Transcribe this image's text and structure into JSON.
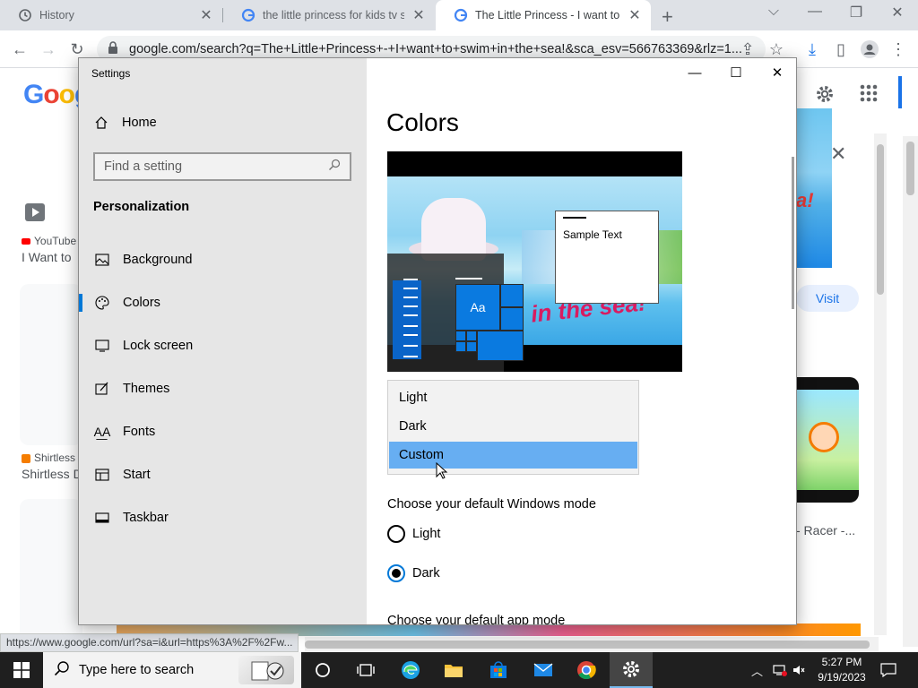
{
  "browser": {
    "tabs": [
      {
        "title": "History",
        "icon": "history-icon"
      },
      {
        "title": "the little princess for kids tv swim",
        "icon": "google-icon"
      },
      {
        "title": "The Little Princess - I want to swim",
        "icon": "google-icon",
        "active": true
      }
    ],
    "address": "google.com/search?q=The+Little+Princess+-+I+want+to+swim+in+the+sea!&sca_esv=566763369&rlz=1..."
  },
  "google": {
    "logo": "Goog",
    "results": [
      {
        "source": "YouTube",
        "title": "I Want to"
      },
      {
        "source": "Shirtless",
        "title": "Shirtless D"
      }
    ],
    "visit_label": "Visit",
    "racer_label": "- Racer -...",
    "status_url": "https://www.google.com/url?sa=i&url=https%3A%2F%2Fw..."
  },
  "settings": {
    "window_title": "Settings",
    "home_label": "Home",
    "search_placeholder": "Find a setting",
    "section": "Personalization",
    "nav": [
      {
        "label": "Background",
        "icon": "picture-icon"
      },
      {
        "label": "Colors",
        "icon": "palette-icon",
        "selected": true
      },
      {
        "label": "Lock screen",
        "icon": "lock-screen-icon"
      },
      {
        "label": "Themes",
        "icon": "themes-icon"
      },
      {
        "label": "Fonts",
        "icon": "fonts-icon"
      },
      {
        "label": "Start",
        "icon": "start-icon"
      },
      {
        "label": "Taskbar",
        "icon": "taskbar-icon"
      }
    ],
    "page_title": "Colors",
    "preview_sample": "Sample Text",
    "preview_tile": "Aa",
    "dropdown_options": [
      "Light",
      "Dark",
      "Custom"
    ],
    "dropdown_selected": "Custom",
    "windows_mode_label": "Choose your default Windows mode",
    "windows_mode_options": [
      "Light",
      "Dark"
    ],
    "windows_mode_selected": "Dark",
    "app_mode_label": "Choose your default app mode",
    "accent_color": "#0078d7"
  },
  "taskbar": {
    "search_placeholder": "Type here to search",
    "time": "5:27 PM",
    "date": "9/19/2023"
  }
}
